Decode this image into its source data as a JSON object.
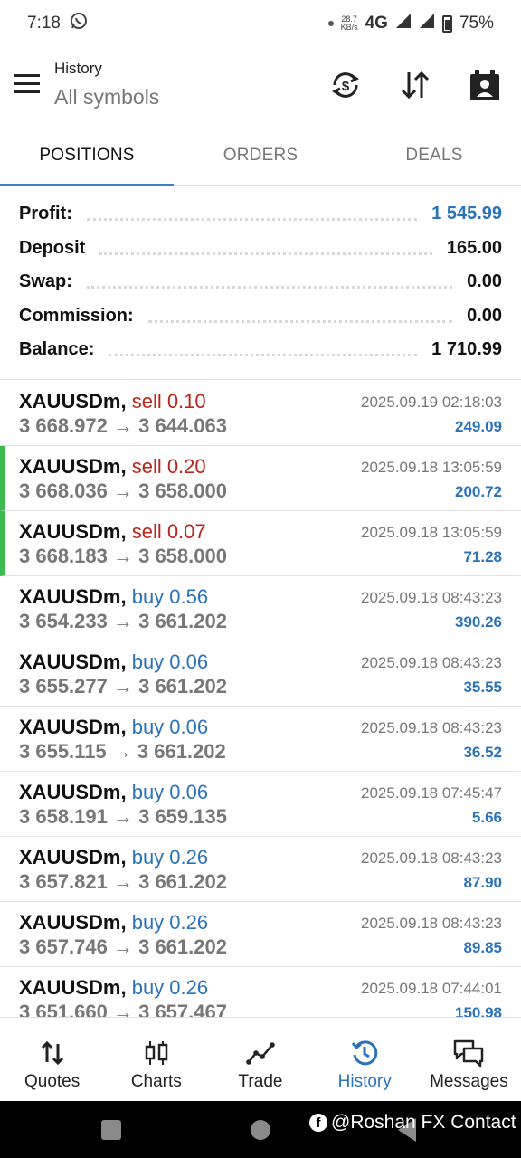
{
  "status_bar": {
    "time": "7:18",
    "whatsapp_icon": "whatsapp-icon",
    "speed_value": "28.7",
    "speed_unit": "KB/s",
    "network": "4G",
    "battery": "75%"
  },
  "header": {
    "subtitle": "History",
    "title": "All symbols",
    "icons": [
      "menu-icon",
      "currency-exchange-icon",
      "sort-icon",
      "calendar-person-icon"
    ]
  },
  "tabs": [
    {
      "label": "POSITIONS",
      "active": true
    },
    {
      "label": "ORDERS",
      "active": false
    },
    {
      "label": "DEALS",
      "active": false
    }
  ],
  "summary": [
    {
      "label": "Profit:",
      "value": "1 545.99"
    },
    {
      "label": "Deposit",
      "value": "165.00"
    },
    {
      "label": "Swap:",
      "value": "0.00"
    },
    {
      "label": "Commission:",
      "value": "0.00"
    },
    {
      "label": "Balance:",
      "value": "1 710.99"
    }
  ],
  "deals": [
    {
      "symbol": "XAUUSDm,",
      "side": "sell 0.10",
      "prices": "3 668.972 → 3 644.063",
      "time": "2025.09.19 02:18:03",
      "profit": "249.09"
    },
    {
      "symbol": "XAUUSDm,",
      "side": "sell 0.20",
      "prices": "3 668.036 → 3 658.000",
      "time": "2025.09.18 13:05:59",
      "profit": "200.72"
    },
    {
      "symbol": "XAUUSDm,",
      "side": "sell 0.07",
      "prices": "3 668.183 → 3 658.000",
      "time": "2025.09.18 13:05:59",
      "profit": "71.28"
    },
    {
      "symbol": "XAUUSDm,",
      "side": "buy 0.56",
      "prices": "3 654.233 → 3 661.202",
      "time": "2025.09.18 08:43:23",
      "profit": "390.26"
    },
    {
      "symbol": "XAUUSDm,",
      "side": "buy 0.06",
      "prices": "3 655.277 → 3 661.202",
      "time": "2025.09.18 08:43:23",
      "profit": "35.55"
    },
    {
      "symbol": "XAUUSDm,",
      "side": "buy 0.06",
      "prices": "3 655.115 → 3 661.202",
      "time": "2025.09.18 08:43:23",
      "profit": "36.52"
    },
    {
      "symbol": "XAUUSDm,",
      "side": "buy 0.06",
      "prices": "3 658.191 → 3 659.135",
      "time": "2025.09.18 07:45:47",
      "profit": "5.66"
    },
    {
      "symbol": "XAUUSDm,",
      "side": "buy 0.26",
      "prices": "3 657.821 → 3 661.202",
      "time": "2025.09.18 08:43:23",
      "profit": "87.90"
    },
    {
      "symbol": "XAUUSDm,",
      "side": "buy 0.26",
      "prices": "3 657.746 → 3 661.202",
      "time": "2025.09.18 08:43:23",
      "profit": "89.85"
    },
    {
      "symbol": "XAUUSDm,",
      "side": "buy 0.26",
      "prices": "3 651.660 → 3 657.467",
      "time": "2025.09.18 07:44:01",
      "profit": "150.98"
    }
  ],
  "bottom_nav": [
    {
      "label": "Quotes",
      "icon": "quotes-icon",
      "active": false
    },
    {
      "label": "Charts",
      "icon": "charts-icon",
      "active": false
    },
    {
      "label": "Trade",
      "icon": "trade-icon",
      "active": false
    },
    {
      "label": "History",
      "icon": "history-icon",
      "active": true
    },
    {
      "label": "Messages",
      "icon": "messages-icon",
      "active": false
    }
  ],
  "watermark": "@Roshan FX Contact",
  "colors": {
    "accent_blue": "#2a73b8",
    "sell_red": "#b8261b",
    "marker_green": "#3dbb4f"
  }
}
